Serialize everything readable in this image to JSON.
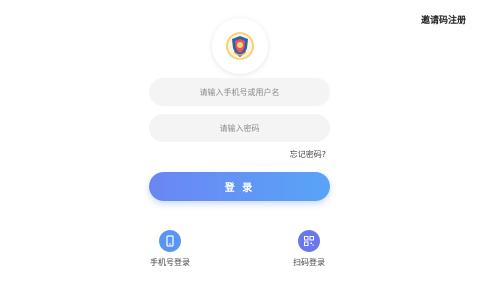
{
  "header": {
    "invite_register": "邀请码注册"
  },
  "login": {
    "username_placeholder": "请输入手机号或用户名",
    "password_placeholder": "请输入密码",
    "forgot_password": "忘记密码?",
    "submit_label": "登 录"
  },
  "alt_login": {
    "phone_label": "手机号登录",
    "scan_label": "扫码登录"
  },
  "colors": {
    "button_start": "#6b86f4",
    "button_end": "#58a4f7",
    "phone_icon_bg": "#5a95f5",
    "scan_icon_bg": "#6a78f0",
    "logo_shield": "#2f5fb3"
  }
}
